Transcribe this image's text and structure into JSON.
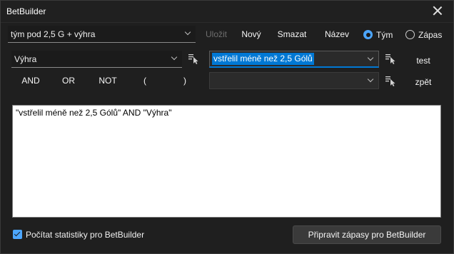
{
  "window": {
    "title": "BetBuilder",
    "close_icon": "close-icon"
  },
  "toolbar": {
    "preset_value": "tým pod 2,5 G + výhra",
    "save_label": "Uložit",
    "new_label": "Nový",
    "delete_label": "Smazat",
    "name_label": "Název",
    "radio_team_label": "Tým",
    "radio_match_label": "Zápas",
    "radio_selected": "Tým"
  },
  "row1": {
    "category_value": "Výhra",
    "condition_value": "vstřelil méně než 2,5 Gólů",
    "test_label": "test"
  },
  "row2": {
    "and_label": "AND",
    "or_label": "OR",
    "not_label": "NOT",
    "open_paren_label": "(",
    "close_paren_label": ")",
    "second_value": "",
    "back_label": "zpět"
  },
  "expression": {
    "text": "\"vstřelil méně než 2,5 Gólů\" AND \"Výhra\""
  },
  "footer": {
    "stats_label": "Počítat statistiky pro BetBuilder",
    "stats_checked": true,
    "prepare_label": "Připravit zápasy pro BetBuilder"
  },
  "colors": {
    "accent": "#0078d4",
    "radio_accent": "#4ca6ff",
    "background": "#1f1f1f"
  }
}
